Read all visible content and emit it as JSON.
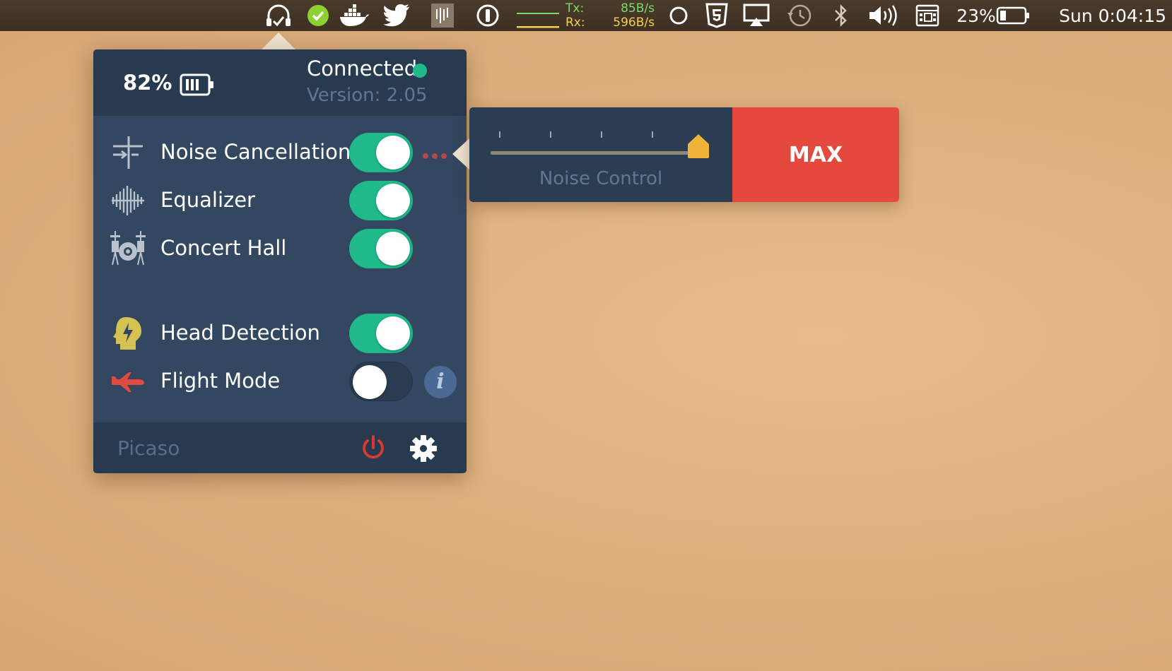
{
  "menubar": {
    "net": {
      "tx_label": "Tx:",
      "rx_label": "Rx:",
      "tx_value": "85B/s",
      "rx_value": "596B/s"
    },
    "battery_pct": "23%",
    "clock": "Sun 0:04:15",
    "icons": [
      "headphones-icon",
      "check-circle-icon",
      "docker-icon",
      "twitter-icon",
      "waveform-app-icon",
      "onepassword-icon",
      "network-graph-icon",
      "circle-icon",
      "html5-shield-icon",
      "airplay-icon",
      "time-machine-icon",
      "bluetooth-icon",
      "volume-icon",
      "keyboard-icon",
      "battery-icon"
    ]
  },
  "panel": {
    "battery_pct": "82%",
    "battery_level": 0.82,
    "status": "Connected",
    "version": "Version: 2.05",
    "items": [
      {
        "label": "Noise Cancellation",
        "icon": "noise-cancellation-icon",
        "on": true
      },
      {
        "label": "Equalizer",
        "icon": "equalizer-icon",
        "on": true
      },
      {
        "label": "Concert Hall",
        "icon": "drum-kit-icon",
        "on": true
      },
      {
        "label": "Head Detection",
        "icon": "head-lightning-icon",
        "on": true
      },
      {
        "label": "Flight Mode",
        "icon": "airplane-icon",
        "on": false
      }
    ],
    "info_glyph": "i",
    "device_name": "Picaso"
  },
  "noise_control": {
    "label": "Noise Control",
    "value_label": "MAX",
    "level": 1.0,
    "accent": "#e5493e",
    "thumb_color": "#f0b43a"
  },
  "colors": {
    "toggle_on": "#1fb98a",
    "panel_bg": "#334760",
    "header_bg": "#283a4f",
    "power": "#d63a33"
  }
}
